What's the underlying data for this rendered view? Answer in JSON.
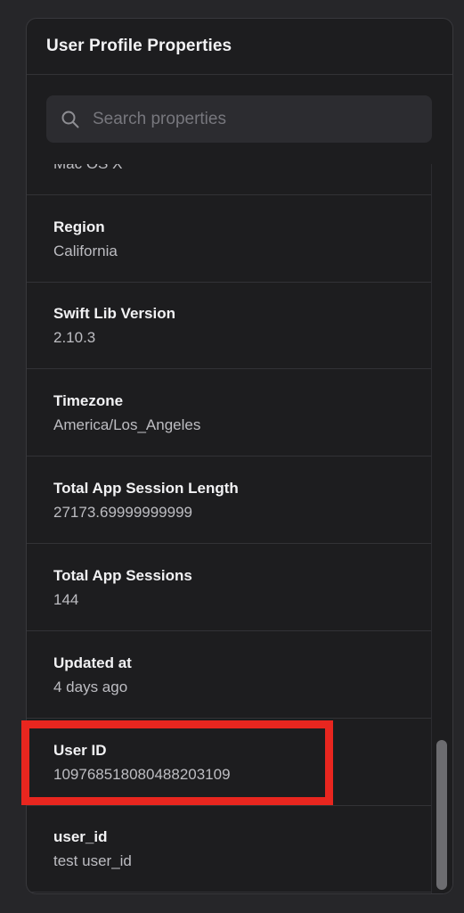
{
  "panel": {
    "title": "User Profile Properties"
  },
  "search": {
    "placeholder": "Search properties",
    "value": ""
  },
  "properties": [
    {
      "name": "",
      "value": "Mac OS X"
    },
    {
      "name": "Region",
      "value": "California"
    },
    {
      "name": "Swift Lib Version",
      "value": "2.10.3"
    },
    {
      "name": "Timezone",
      "value": "America/Los_Angeles"
    },
    {
      "name": "Total App Session Length",
      "value": "27173.69999999999"
    },
    {
      "name": "Total App Sessions",
      "value": "144"
    },
    {
      "name": "Updated at",
      "value": "4 days ago"
    },
    {
      "name": "User ID",
      "value": "109768518080488203109"
    },
    {
      "name": "user_id",
      "value": "test user_id"
    }
  ],
  "colors": {
    "highlight": "#e8261f",
    "background": "#1d1d1f"
  },
  "icons": {
    "search": "search-icon"
  }
}
